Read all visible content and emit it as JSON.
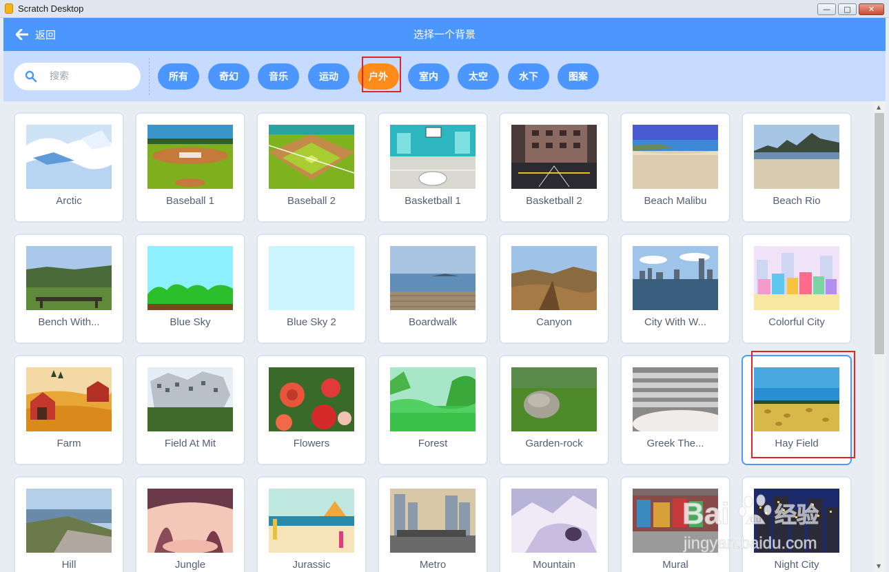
{
  "window": {
    "title": "Scratch Desktop",
    "controls": [
      "—",
      "□",
      "✕"
    ]
  },
  "header": {
    "back_label": "返回",
    "title": "选择一个背景"
  },
  "search": {
    "placeholder": "搜索"
  },
  "tags": [
    {
      "label": "所有",
      "active": false
    },
    {
      "label": "奇幻",
      "active": false
    },
    {
      "label": "音乐",
      "active": false
    },
    {
      "label": "运动",
      "active": false
    },
    {
      "label": "户外",
      "active": true
    },
    {
      "label": "室内",
      "active": false
    },
    {
      "label": "太空",
      "active": false
    },
    {
      "label": "水下",
      "active": false
    },
    {
      "label": "图案",
      "active": false
    }
  ],
  "backdrops": [
    {
      "name": "Arctic",
      "thumb": "arctic"
    },
    {
      "name": "Baseball 1",
      "thumb": "baseball1"
    },
    {
      "name": "Baseball 2",
      "thumb": "baseball2"
    },
    {
      "name": "Basketball 1",
      "thumb": "basketball1"
    },
    {
      "name": "Basketball 2",
      "thumb": "basketball2"
    },
    {
      "name": "Beach Malibu",
      "thumb": "beach-malibu"
    },
    {
      "name": "Beach Rio",
      "thumb": "beach-rio"
    },
    {
      "name": "Bench With...",
      "thumb": "bench"
    },
    {
      "name": "Blue Sky",
      "thumb": "blue-sky"
    },
    {
      "name": "Blue Sky 2",
      "thumb": "blue-sky-2"
    },
    {
      "name": "Boardwalk",
      "thumb": "boardwalk"
    },
    {
      "name": "Canyon",
      "thumb": "canyon"
    },
    {
      "name": "City With W...",
      "thumb": "city-water"
    },
    {
      "name": "Colorful City",
      "thumb": "colorful-city"
    },
    {
      "name": "Farm",
      "thumb": "farm"
    },
    {
      "name": "Field At Mit",
      "thumb": "field-mit"
    },
    {
      "name": "Flowers",
      "thumb": "flowers"
    },
    {
      "name": "Forest",
      "thumb": "forest"
    },
    {
      "name": "Garden-rock",
      "thumb": "garden-rock"
    },
    {
      "name": "Greek The...",
      "thumb": "greek-theater"
    },
    {
      "name": "Hay Field",
      "thumb": "hay-field",
      "selected": true
    },
    {
      "name": "Hill",
      "thumb": "hill"
    },
    {
      "name": "Jungle",
      "thumb": "jungle"
    },
    {
      "name": "Jurassic",
      "thumb": "jurassic"
    },
    {
      "name": "Metro",
      "thumb": "metro"
    },
    {
      "name": "Mountain",
      "thumb": "mountain"
    },
    {
      "name": "Mural",
      "thumb": "mural"
    },
    {
      "name": "Night City",
      "thumb": "night-city"
    }
  ],
  "watermark": {
    "brand": "Bai 经验",
    "url": "jingyan.baidu.com"
  },
  "colors": {
    "accent": "#4c97ff",
    "active_tag": "#ff8c1a",
    "highlight": "#e02424",
    "filter_bg": "#c6dbff"
  }
}
